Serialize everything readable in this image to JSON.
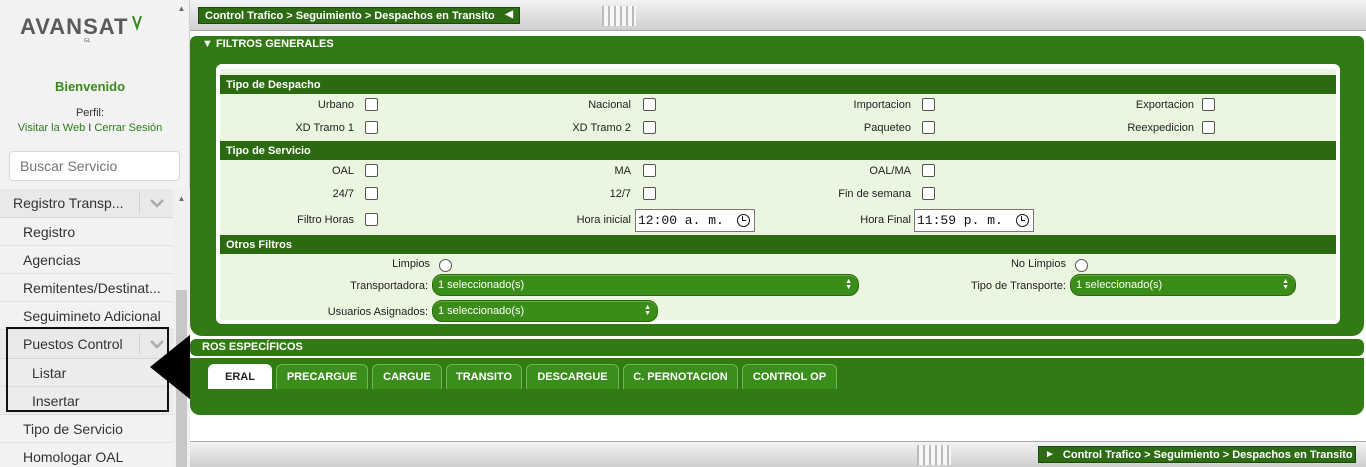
{
  "sidebar": {
    "brand": "AVANSAT",
    "welcome": "Bienvenido",
    "perfil": "Perfil:",
    "visitar_web": "Visitar la Web",
    "separator": "I",
    "cerrar_sesion": "Cerrar Sesión",
    "search_placeholder": "Buscar Servicio",
    "menu": {
      "group1": "Registro Transp...",
      "items_a": [
        "Registro",
        "Agencias",
        "Remitentes/Destinat...",
        "Seguimineto Adicional"
      ],
      "group2": "Puestos Control",
      "sub": [
        "Listar",
        "Insertar"
      ],
      "items_b": [
        "Tipo de Servicio",
        "Homologar OAL"
      ]
    }
  },
  "breadcrumb": "Control Trafico > Seguimiento > Despachos en Transito",
  "filtros_generales": {
    "title": "FILTROS GENERALES",
    "tipo_despacho": {
      "title": "Tipo de Despacho",
      "row1": [
        "Urbano",
        "Nacional",
        "Importacion",
        "Exportacion"
      ],
      "row2": [
        "XD Tramo 1",
        "XD Tramo 2",
        "Paqueteo",
        "Reexpedicion"
      ]
    },
    "tipo_servicio": {
      "title": "Tipo de Servicio",
      "row1": [
        "OAL",
        "MA",
        "OAL/MA"
      ],
      "row2": [
        "24/7",
        "12/7",
        "Fin de semana"
      ],
      "filtro_horas": "Filtro Horas",
      "hora_inicial_label": "Hora inicial",
      "hora_inicial": "12:00 a. m.",
      "hora_final_label": "Hora Final",
      "hora_final": "11:59 p. m."
    },
    "otros": {
      "title": "Otros Filtros",
      "limpios": "Limpios",
      "no_limpios": "No Limpios",
      "transportadora_label": "Transportadora:",
      "transportadora_value": "1 seleccionado(s)",
      "tipo_transporte_label": "Tipo de Transporte:",
      "tipo_transporte_value": "1 seleccionado(s)",
      "usuarios_label": "Usuarios Asignados:",
      "usuarios_value": "1 seleccionado(s)"
    }
  },
  "filtros_especificos": {
    "title": "ROS ESPECÍFICOS",
    "tabs": [
      "ERAL",
      "PRECARGUE",
      "CARGUE",
      "TRANSITO",
      "DESCARGUE",
      "C. PERNOTACION",
      "CONTROL OP"
    ],
    "active_tab": "ERAL"
  },
  "colors": {
    "primary_green": "#327a13",
    "dark_green": "#2c6a12",
    "panel_bg": "#eaf6df",
    "accent": "#3a8a1e"
  }
}
